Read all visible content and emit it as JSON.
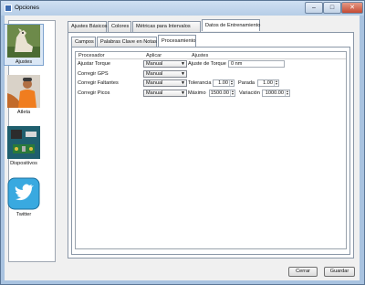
{
  "window": {
    "title": "Opciones"
  },
  "sidebar": {
    "items": [
      {
        "label": "Ajustes",
        "icon": "dog-icon",
        "selected": true
      },
      {
        "label": "Atleta",
        "icon": "athlete-icon",
        "selected": false
      },
      {
        "label": "Dispositivos",
        "icon": "circuit-board-icon",
        "selected": false
      },
      {
        "label": "Twitter",
        "icon": "twitter-bird-icon",
        "selected": false
      }
    ]
  },
  "tabs": [
    {
      "label": "Ajustes Básicos"
    },
    {
      "label": "Colores"
    },
    {
      "label": "Métricas para Intervalos"
    },
    {
      "label": "Datos de Entrenamiento",
      "active": true
    }
  ],
  "subtabs": [
    {
      "label": "Campos"
    },
    {
      "label": "Palabras Clave en Notas"
    },
    {
      "label": "Procesamiento",
      "active": true
    }
  ],
  "table": {
    "headers": [
      "Procesador",
      "Aplicar",
      "Ajustes"
    ],
    "rows": [
      {
        "name": "Ajustar Torque",
        "apply": "Manual",
        "s1_label": "Ajuste de Torque",
        "s1_value": "0 nm"
      },
      {
        "name": "Corregir GPS",
        "apply": "Manual"
      },
      {
        "name": "Corregir Faltantes",
        "apply": "Manual",
        "s1_label": "Tolerancia",
        "s1_value": "1.00",
        "s2_label": "Parada",
        "s2_value": "1.00"
      },
      {
        "name": "Corregir Picos",
        "apply": "Manual",
        "s1_label": "Máximo",
        "s1_value": "1500.00",
        "s2_label": "Variación",
        "s2_value": "1000.00"
      }
    ]
  },
  "footer": {
    "close_label": "Cerrar",
    "save_label": "Guardar"
  }
}
